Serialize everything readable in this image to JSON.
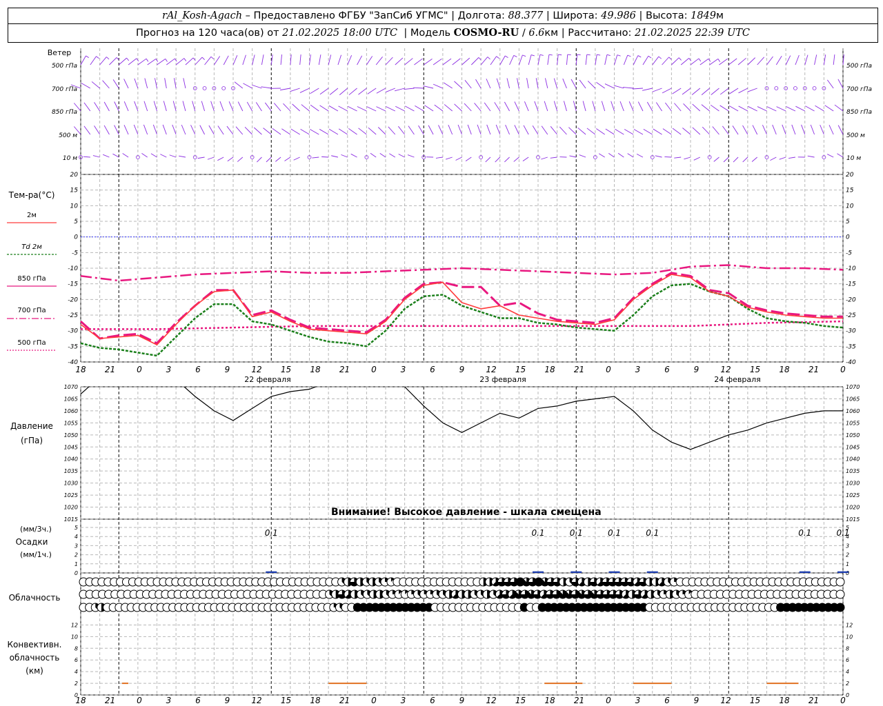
{
  "header": {
    "station": "rAl_Kosh-Agach",
    "provider": "Предоставлено ФГБУ \"ЗапСиб УГМС\"",
    "lon_label": "Долгота:",
    "lon": "88.377",
    "lat_label": "Широта:",
    "lat": "49.986",
    "alt_label": "Высота:",
    "alt": "1849",
    "alt_unit": "м",
    "forecast_label": "Прогноз на 120 часа(ов) от",
    "forecast_start": "21.02.2025 18:00 UTC",
    "model_label": "Модель",
    "model": "COSMO-RU",
    "resolution": "6.6",
    "resolution_unit": "км",
    "calc_label": "Рассчитано:",
    "calc_time": "21.02.2025 22:39 UTC"
  },
  "colors": {
    "wind": "#8a2be2",
    "t2m": "#ff3b3b",
    "td2m": "#1a7f1a",
    "t850": "#e8177f",
    "t700": "#e8177f",
    "t500": "#e8177f",
    "zero": "#3333ff",
    "pressure": "#000000",
    "precip": "#1f3fb0",
    "conv": "#e07020",
    "grid": "#9a9a9a"
  },
  "time_axis": {
    "tick_labels": [
      "18",
      "21",
      "0",
      "3",
      "6",
      "9",
      "12",
      "15",
      "18",
      "21",
      "0",
      "3",
      "6",
      "9",
      "12",
      "15",
      "18",
      "21",
      "0",
      "3",
      "6",
      "9",
      "12",
      "15",
      "18",
      "21",
      "0"
    ],
    "days": [
      "22 февраля",
      "23 февраля",
      "24 февраля"
    ]
  },
  "wind_panel": {
    "title": "Ветер",
    "levels": [
      "500 гПа",
      "700 гПа",
      "850 гПа",
      "500 м",
      "10  м"
    ]
  },
  "temp_panel": {
    "title": "Тем-ра(°C)",
    "legend": [
      {
        "label": "2м",
        "key": "t2m"
      },
      {
        "label": "Td 2м",
        "key": "td2m"
      },
      {
        "label": "850 гПа",
        "key": "t850"
      },
      {
        "label": "700 гПа",
        "key": "t700"
      },
      {
        "label": "500 гПа",
        "key": "t500"
      }
    ],
    "ticks": [
      "20",
      "15",
      "10",
      "5",
      "0",
      "-5",
      "-10",
      "-15",
      "-20",
      "-25",
      "-30",
      "-35",
      "-40"
    ]
  },
  "pressure_panel": {
    "title": "Давление",
    "unit": "(гПа)",
    "ticks": [
      "1070",
      "1065",
      "1060",
      "1055",
      "1050",
      "1045",
      "1040",
      "1035",
      "1030",
      "1025",
      "1020",
      "1015"
    ],
    "warning": "Внимание! Высокое давление - шкала смещена"
  },
  "precip_panel": {
    "unit3": "(мм/3ч.)",
    "title": "Осадки",
    "unit1": "(мм/1ч.)",
    "ticks": [
      "5",
      "4",
      "3",
      "2",
      "1",
      "0"
    ],
    "labels": [
      {
        "hour": 30,
        "text": "0.1"
      },
      {
        "hour": 72,
        "text": "0.1"
      },
      {
        "hour": 78,
        "text": "0.1"
      },
      {
        "hour": 84,
        "text": "0.1"
      },
      {
        "hour": 90,
        "text": "0.1"
      },
      {
        "hour": 114,
        "text": "0.1"
      },
      {
        "hour": 120,
        "text": "0.1"
      }
    ]
  },
  "cloud_panel": {
    "title": "Облачность"
  },
  "conv_panel": {
    "title1": "Конвективн.",
    "title2": "облачность",
    "unit": "(км)",
    "ticks": [
      "12",
      "10",
      "8",
      "6",
      "4",
      "2",
      "0"
    ]
  },
  "chart_data": [
    {
      "type": "line",
      "title": "Тем-ра(°C)",
      "x_unit": "hours since 21.02.2025 18:00 UTC",
      "ylim": [
        -40,
        20
      ],
      "grid": true,
      "series": [
        {
          "name": "2м",
          "x": [
            0,
            3,
            6,
            9,
            12,
            15,
            18,
            21,
            24,
            27,
            30,
            33,
            36,
            39,
            42,
            45,
            48,
            51,
            54,
            57,
            60,
            63,
            66,
            69,
            72,
            75,
            78,
            81,
            84,
            87,
            90,
            93,
            96,
            99,
            102,
            105,
            108,
            111,
            114,
            117,
            120
          ],
          "values": [
            -28,
            -32.5,
            -32,
            -31.5,
            -34.5,
            -28,
            -22,
            -17.5,
            -17,
            -25.5,
            -24,
            -27,
            -29.5,
            -30,
            -30.5,
            -31,
            -27,
            -20,
            -15.5,
            -14.5,
            -21,
            -23,
            -22,
            -25,
            -26,
            -27,
            -27.5,
            -28,
            -26.5,
            -20,
            -15.5,
            -12,
            -13,
            -17.5,
            -19,
            -22.5,
            -24,
            -25,
            -25.5,
            -26,
            -26
          ]
        },
        {
          "name": "Td 2м",
          "x": [
            0,
            3,
            6,
            9,
            12,
            15,
            18,
            21,
            24,
            27,
            30,
            33,
            36,
            39,
            42,
            45,
            48,
            51,
            54,
            57,
            60,
            63,
            66,
            69,
            72,
            75,
            78,
            81,
            84,
            87,
            90,
            93,
            96,
            99,
            102,
            105,
            108,
            111,
            114,
            117,
            120
          ],
          "values": [
            -34,
            -35.5,
            -36,
            -37,
            -38,
            -32,
            -26,
            -21.5,
            -21.5,
            -27,
            -28,
            -30,
            -32,
            -33.5,
            -34,
            -35,
            -30,
            -23,
            -19,
            -18.5,
            -22,
            -24,
            -26,
            -26,
            -27.5,
            -28,
            -29,
            -29.5,
            -30,
            -25,
            -19,
            -15.5,
            -15,
            -17.5,
            -19,
            -23,
            -26,
            -27,
            -27.5,
            -28.5,
            -29
          ]
        },
        {
          "name": "850 гПа",
          "x": [
            0,
            3,
            6,
            9,
            12,
            15,
            18,
            21,
            24,
            27,
            30,
            33,
            36,
            39,
            42,
            45,
            48,
            51,
            54,
            57,
            60,
            63,
            66,
            69,
            72,
            75,
            78,
            81,
            84,
            87,
            90,
            93,
            96,
            99,
            102,
            105,
            108,
            111,
            114,
            117,
            120
          ],
          "values": [
            -27,
            -32.5,
            -31.5,
            -31,
            -34,
            -27.5,
            -22,
            -17,
            -17,
            -25,
            -23.5,
            -26.5,
            -29,
            -29.5,
            -30,
            -30.5,
            -26.5,
            -19.5,
            -15,
            -14.5,
            -16,
            -16,
            -22,
            -21,
            -24.5,
            -26.5,
            -27,
            -27.5,
            -26,
            -19.5,
            -15,
            -11.5,
            -12.5,
            -17,
            -18,
            -22,
            -23.5,
            -24.5,
            -25,
            -25.5,
            -25.5
          ]
        },
        {
          "name": "700 гПа",
          "x": [
            0,
            6,
            12,
            18,
            24,
            30,
            36,
            42,
            48,
            54,
            60,
            66,
            72,
            78,
            84,
            90,
            96,
            102,
            108,
            114,
            120
          ],
          "values": [
            -12.5,
            -14,
            -13,
            -12,
            -11.5,
            -11,
            -11.5,
            -11.5,
            -11,
            -10.5,
            -10,
            -10.5,
            -11,
            -11.5,
            -12,
            -11.5,
            -9.5,
            -9,
            -10,
            -10,
            -10.5
          ]
        },
        {
          "name": "500 гПа",
          "x": [
            0,
            12,
            24,
            36,
            48,
            60,
            72,
            84,
            96,
            108,
            120
          ],
          "values": [
            -29.5,
            -29.5,
            -29,
            -28.5,
            -28.5,
            -28.5,
            -28.5,
            -28.5,
            -28.5,
            -27.5,
            -27
          ]
        }
      ]
    },
    {
      "type": "line",
      "title": "Давление",
      "ylabel": "(гПа)",
      "ylim": [
        1015,
        1070
      ],
      "series": [
        {
          "x": [
            0,
            3,
            6,
            9,
            12,
            15,
            18,
            21,
            24,
            27,
            30,
            33,
            36,
            39,
            42,
            45,
            48,
            51,
            54,
            57,
            60,
            63,
            66,
            69,
            72,
            75,
            78,
            81,
            84,
            87,
            90,
            93,
            96,
            99,
            102,
            105,
            108,
            111,
            114,
            117,
            120
          ],
          "values": [
            1067,
            1074,
            1076,
            1077,
            1076,
            1073,
            1066,
            1060,
            1056,
            1061,
            1066,
            1068,
            1069,
            1072,
            1075,
            1076,
            1076,
            1070,
            1062,
            1055,
            1051,
            1055,
            1059,
            1057,
            1061,
            1062,
            1064,
            1065,
            1066,
            1060,
            1052,
            1047,
            1044,
            1047,
            1050,
            1052,
            1055,
            1057,
            1059,
            1060,
            1060
          ]
        }
      ]
    },
    {
      "type": "bar",
      "title": "Осадки",
      "ylim": [
        0,
        5
      ],
      "x": [
        30,
        72,
        78,
        84,
        90,
        114,
        120
      ],
      "values": [
        0.1,
        0.1,
        0.1,
        0.1,
        0.1,
        0.1,
        0.1
      ]
    },
    {
      "type": "line",
      "title": "Конвективн. облачность",
      "ylabel": "(км)",
      "ylim": [
        0,
        13
      ],
      "series": [
        {
          "x": [
            6.5,
            7.5
          ],
          "values": [
            2,
            2
          ]
        },
        {
          "x": [
            39,
            45
          ],
          "values": [
            2,
            2
          ]
        },
        {
          "x": [
            73,
            79
          ],
          "values": [
            2,
            2
          ]
        },
        {
          "x": [
            87,
            93
          ],
          "values": [
            2,
            2
          ]
        },
        {
          "x": [
            108,
            113
          ],
          "values": [
            2,
            2
          ]
        }
      ]
    },
    {
      "type": "table",
      "title": "Облачность",
      "rows_octas": [
        [
          0,
          0,
          0,
          0,
          0,
          0,
          0,
          0,
          0,
          0,
          0,
          0,
          0,
          0,
          0,
          0,
          0,
          0,
          0,
          0,
          0,
          0,
          0,
          0,
          0,
          0,
          0,
          0,
          0,
          0,
          0,
          0,
          0,
          0,
          0,
          0,
          0,
          0,
          0,
          0,
          0,
          0,
          3,
          4,
          6,
          4,
          3,
          4,
          3,
          2,
          1,
          0,
          0,
          0,
          0,
          0,
          0,
          0,
          0,
          0,
          0,
          0,
          0,
          0,
          0,
          4,
          4,
          5,
          6,
          6,
          6,
          8,
          7,
          6,
          8,
          7,
          6,
          6,
          4,
          3,
          6,
          5,
          4,
          6,
          5,
          6,
          6,
          6,
          6,
          6,
          5,
          6,
          4,
          4,
          5,
          3,
          2,
          0,
          0,
          0,
          0,
          0,
          0,
          0,
          0,
          0,
          0,
          0,
          0,
          0,
          0,
          0,
          0,
          0,
          0,
          0,
          0,
          0,
          0,
          0,
          0,
          0,
          0,
          0
        ],
        [
          0,
          0,
          0,
          0,
          0,
          0,
          0,
          0,
          0,
          0,
          0,
          0,
          0,
          0,
          0,
          0,
          0,
          0,
          0,
          0,
          0,
          0,
          0,
          0,
          0,
          0,
          0,
          0,
          0,
          0,
          0,
          0,
          0,
          0,
          0,
          0,
          0,
          0,
          0,
          3,
          4,
          6,
          5,
          4,
          3,
          3,
          4,
          4,
          3,
          2,
          1,
          1,
          2,
          3,
          2,
          2,
          3,
          3,
          4,
          5,
          4,
          4,
          3,
          3,
          4,
          3,
          5,
          6,
          5,
          7,
          6,
          7,
          6,
          5,
          6,
          6,
          7,
          7,
          6,
          7,
          6,
          7,
          6,
          6,
          6,
          6,
          5,
          4,
          6,
          5,
          4,
          3,
          2,
          4,
          3,
          2,
          1,
          0,
          0,
          0,
          0,
          0,
          0,
          0,
          0,
          0,
          0,
          0,
          0,
          0,
          0,
          0,
          0,
          0,
          0,
          0,
          0,
          0,
          0,
          0,
          0
        ],
        [
          0,
          0,
          3,
          4,
          0,
          0,
          0,
          0,
          0,
          0,
          0,
          0,
          0,
          0,
          0,
          0,
          0,
          0,
          0,
          0,
          0,
          0,
          0,
          0,
          0,
          0,
          0,
          0,
          0,
          0,
          0,
          0,
          0,
          0,
          0,
          0,
          0,
          0,
          0,
          0,
          0,
          0,
          2,
          3,
          0,
          0,
          8,
          8,
          8,
          8,
          8,
          8,
          8,
          8,
          8,
          8,
          8,
          8,
          8,
          0,
          0,
          0,
          0,
          0,
          0,
          0,
          0,
          0,
          0,
          0,
          0,
          0,
          0,
          0,
          8,
          0,
          0,
          8,
          8,
          8,
          8,
          8,
          8,
          8,
          8,
          8,
          8,
          8,
          8,
          8,
          8,
          8,
          8,
          8,
          8,
          0,
          0,
          0,
          0,
          0,
          0,
          0,
          0,
          0,
          0,
          0,
          0,
          0,
          0,
          0,
          0,
          0,
          0,
          0,
          0,
          0,
          0,
          8,
          8,
          8,
          8,
          8,
          8,
          8,
          8,
          8,
          8,
          8
        ]
      ]
    }
  ]
}
